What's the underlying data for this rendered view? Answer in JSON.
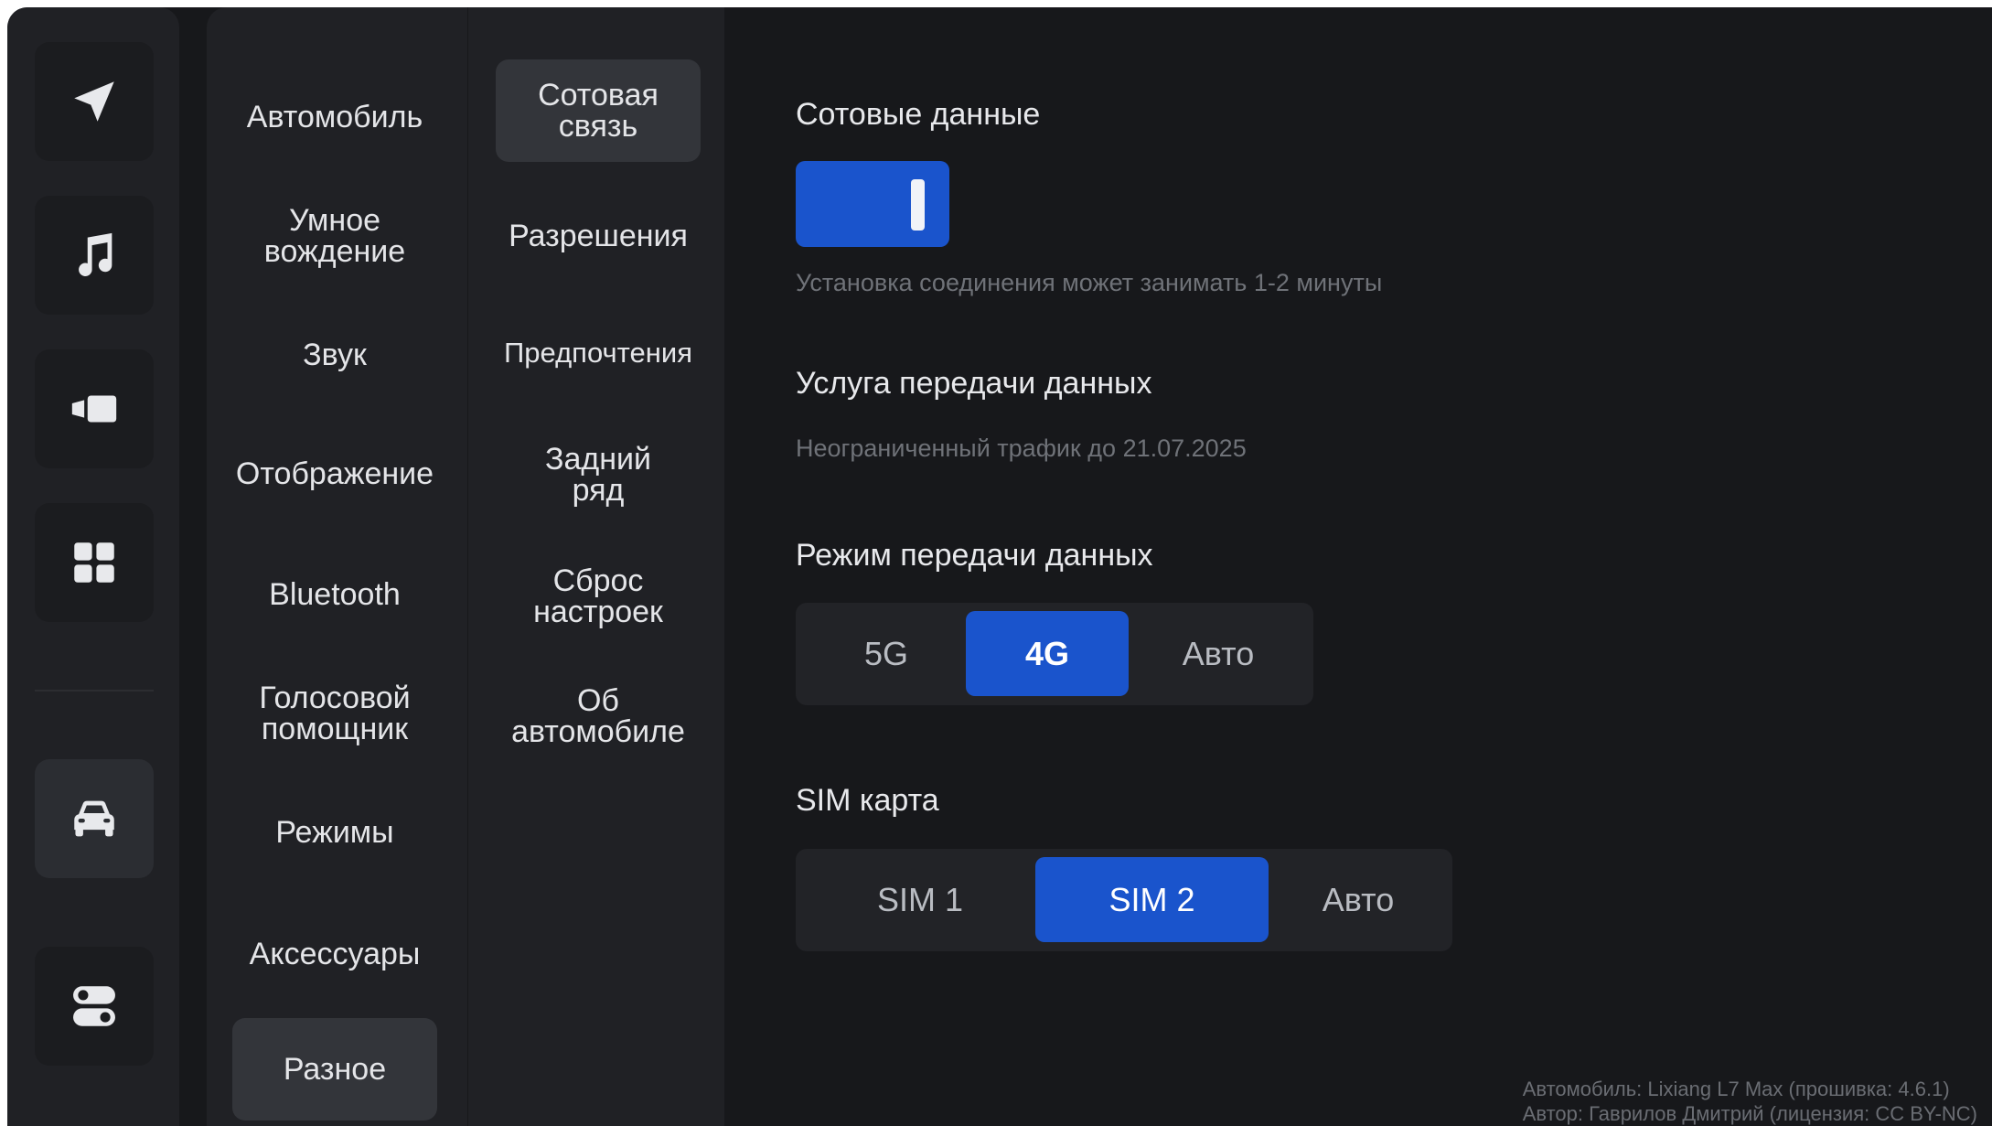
{
  "dock": {
    "items": [
      {
        "icon": "navigation-icon"
      },
      {
        "icon": "music-note-icon"
      },
      {
        "icon": "video-camera-icon"
      },
      {
        "icon": "apps-grid-icon"
      },
      {
        "icon": "car-icon",
        "active": true
      },
      {
        "icon": "toggles-icon"
      }
    ]
  },
  "categories": [
    {
      "label": "Автомобиль"
    },
    {
      "label": "Умное\nвождение"
    },
    {
      "label": "Звук"
    },
    {
      "label": "Отображение"
    },
    {
      "label": "Bluetooth"
    },
    {
      "label": "Голосовой\nпомощник"
    },
    {
      "label": "Режимы"
    },
    {
      "label": "Аксессуары"
    },
    {
      "label": "Разное",
      "active": true
    }
  ],
  "subcategories": [
    {
      "label": "Сотовая\nсвязь",
      "active": true
    },
    {
      "label": "Разрешения"
    },
    {
      "label": "Предпочтения"
    },
    {
      "label": "Задний\nряд"
    },
    {
      "label": "Сброс\nнастроек"
    },
    {
      "label": "Об\nавтомобиле"
    }
  ],
  "content": {
    "cellular": {
      "title": "Сотовые данные",
      "enabled": true,
      "hint": "Установка соединения может занимать 1-2 минуты"
    },
    "service": {
      "title": "Услуга передачи данных",
      "detail": "Неограниченный трафик до 21.07.2025"
    },
    "mode": {
      "title": "Режим передачи данных",
      "options": [
        "5G",
        "4G",
        "Авто"
      ],
      "selected": "4G"
    },
    "sim": {
      "title": "SIM карта",
      "options": [
        "SIM 1",
        "SIM 2",
        "Авто"
      ],
      "selected": "SIM 2"
    }
  },
  "footer": {
    "line1": "Автомобиль: Lixiang L7 Max (прошивка: 4.6.1)",
    "line2": "Автор: Гаврилов Дмитрий (лицензия: CC BY-NC)"
  },
  "colors": {
    "accent": "#1a54cc",
    "background": "#17181b",
    "panel": "#202125"
  }
}
